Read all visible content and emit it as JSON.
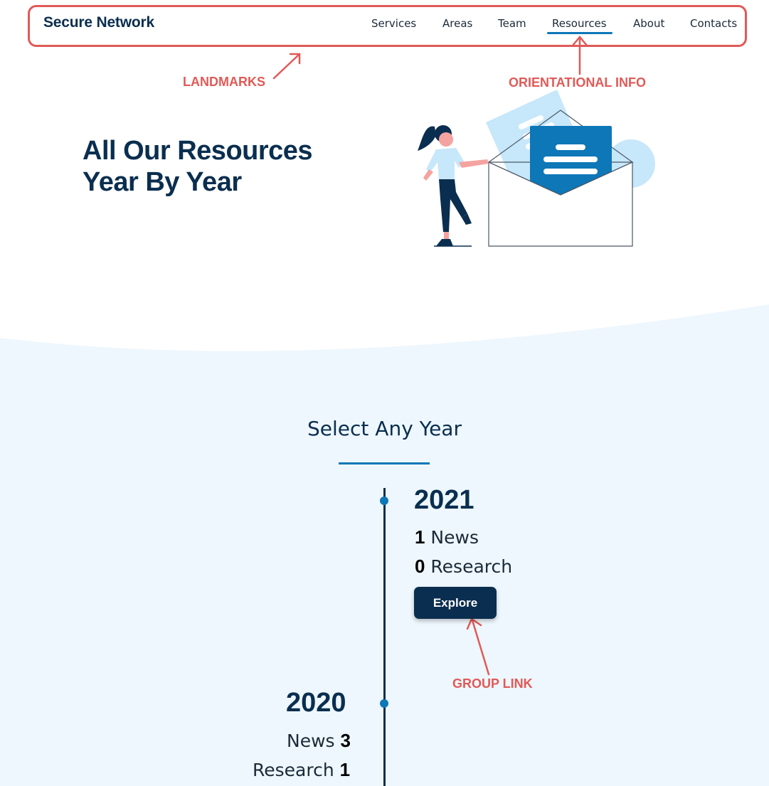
{
  "nav": {
    "brand": "Secure Network",
    "items": [
      {
        "label": "Services"
      },
      {
        "label": "Areas"
      },
      {
        "label": "Team"
      },
      {
        "label": "Resources",
        "active": true
      },
      {
        "label": "About"
      },
      {
        "label": "Contacts"
      }
    ]
  },
  "annotations": {
    "landmarks": "LANDMARKS",
    "orientational": "ORIENTATIONAL INFO",
    "group_link": "GROUP LINK"
  },
  "hero": {
    "title_line1": "All Our Resources",
    "title_line2": "Year By Year"
  },
  "timeline": {
    "heading": "Select Any Year",
    "years": [
      {
        "year": "2021",
        "news_count": "1",
        "news_label": "News",
        "research_count": "0",
        "research_label": "Research",
        "button": "Explore"
      },
      {
        "year": "2020",
        "news_count": "3",
        "news_label": "News",
        "research_count": "1",
        "research_label": "Research"
      }
    ]
  },
  "colors": {
    "navy": "#0a2e4f",
    "accent_blue": "#0d77b8",
    "annotation_red": "#e05a57",
    "section_bg": "#eef7fd"
  }
}
